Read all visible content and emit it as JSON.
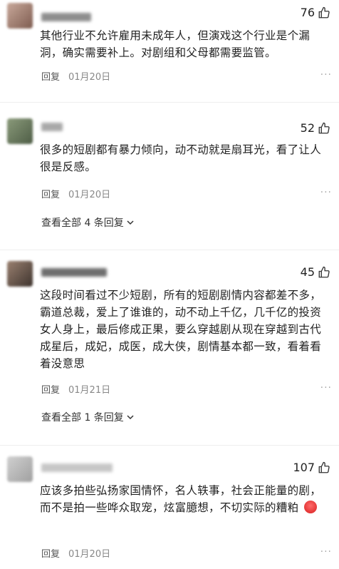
{
  "comments": [
    {
      "likes": "76",
      "text": "其他行业不允许雇用未成年人，但演戏这个行业是个漏洞，确实需要补上。对剧组和父母都需要监管。",
      "reply_label": "回复",
      "date": "01月20日"
    },
    {
      "likes": "52",
      "text": "很多的短剧都有暴力倾向，动不动就是扇耳光，看了让人很是反感。",
      "reply_label": "回复",
      "date": "01月20日",
      "expand_label": "查看全部 4 条回复"
    },
    {
      "likes": "45",
      "text": "这段时间看过不少短剧，所有的短剧剧情内容都差不多，霸道总裁，爱上了谁谁的，动不动上千亿，几千亿的投资女人身上，最后修成正果，要么穿越剧从现在穿越到古代成星后，成妃，成医，成大侠，剧情基本都一致，看着看着没意思",
      "reply_label": "回复",
      "date": "01月21日",
      "expand_label": "查看全部 1 条回复"
    },
    {
      "likes": "107",
      "text": "应该多拍些弘扬家国情怀，名人轶事，社会正能量的剧，而不是拍一些哗众取宠，炫富臆想，不切实际的糟粕",
      "reply_label": "回复",
      "date": "01月20日"
    }
  ],
  "icons": {
    "like": "thumbs-up-icon",
    "more": "more-dots-icon",
    "expand": "chevron-down-icon"
  }
}
